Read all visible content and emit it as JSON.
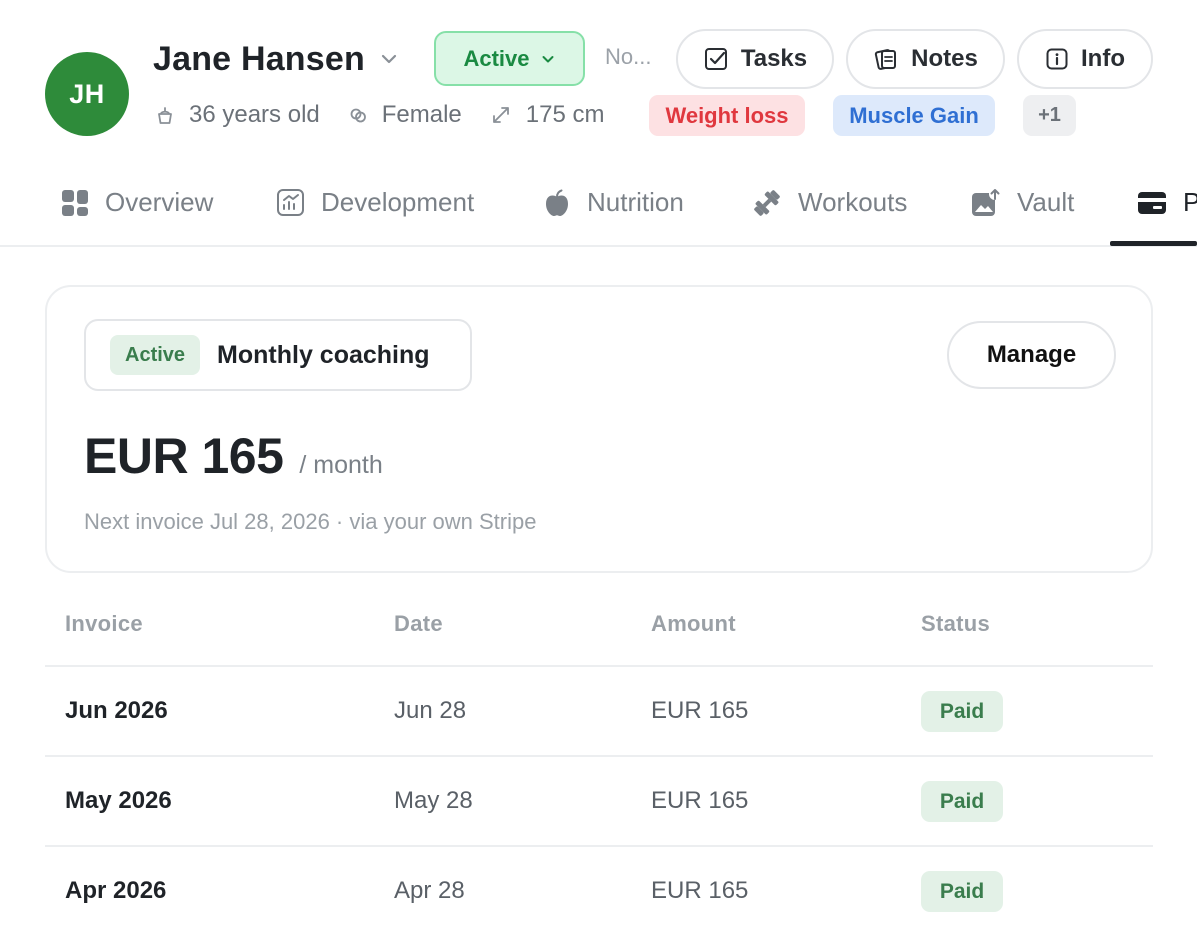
{
  "client": {
    "initials": "JH",
    "name": "Jane Hansen",
    "status": "Active",
    "note_preview": "No...",
    "age": "36 years old",
    "gender": "Female",
    "height": "175 cm",
    "goals": [
      "Weight loss",
      "Muscle Gain"
    ],
    "goals_more": "+1"
  },
  "header_actions": {
    "tasks": "Tasks",
    "notes": "Notes",
    "info": "Info"
  },
  "tabs": [
    {
      "label": "Overview"
    },
    {
      "label": "Development"
    },
    {
      "label": "Nutrition"
    },
    {
      "label": "Workouts"
    },
    {
      "label": "Vault"
    },
    {
      "label": "P"
    }
  ],
  "subscription": {
    "status": "Active",
    "plan": "Monthly coaching",
    "manage_label": "Manage",
    "price": "EUR 165",
    "period": "/ month",
    "next_invoice": "Next invoice Jul 28, 2026 · via your own Stripe"
  },
  "invoices": {
    "headers": [
      "Invoice",
      "Date",
      "Amount",
      "Status"
    ],
    "rows": [
      {
        "invoice": "Jun 2026",
        "date": "Jun 28",
        "amount": "EUR 165",
        "status": "Paid"
      },
      {
        "invoice": "May 2026",
        "date": "May 28",
        "amount": "EUR 165",
        "status": "Paid"
      },
      {
        "invoice": "Apr 2026",
        "date": "Apr 28",
        "amount": "EUR 165",
        "status": "Paid"
      }
    ]
  },
  "colors": {
    "avatar": "#2e8b3a",
    "active_green": "#1a8a42",
    "weight_loss_red": "#e0383f",
    "muscle_gain_blue": "#2f6fd3"
  },
  "icons": {
    "name_dropdown": "chevron-down-icon",
    "tasks": "checkbox-icon",
    "notes": "notes-icon",
    "info": "info-icon",
    "age": "cake-icon",
    "gender": "gender-icon",
    "height": "ruler-diagonal-icon",
    "overview": "grid-icon",
    "development": "chart-icon",
    "nutrition": "apple-icon",
    "workouts": "dumbbell-icon",
    "vault": "image-upload-icon",
    "payments": "card-icon"
  }
}
